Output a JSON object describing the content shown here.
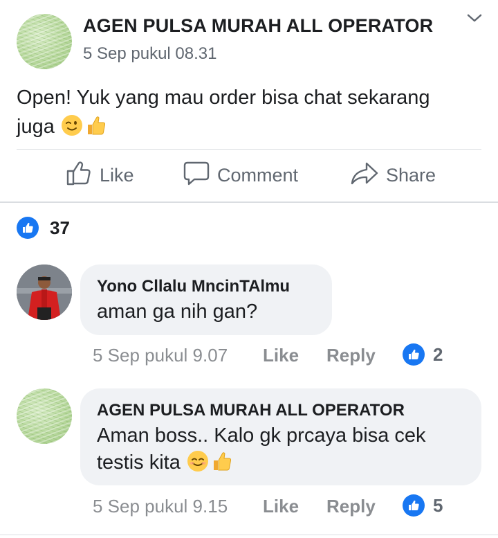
{
  "post": {
    "author": "AGEN PULSA MURAH ALL OPERATOR",
    "timestamp": "5 Sep pukul 08.31",
    "text_line1": "Open! Yuk yang mau order bisa chat sekarang",
    "text_line2": "juga",
    "emojis": [
      "winking-face-emoji",
      "thumbs-up-emoji"
    ]
  },
  "actions": {
    "like_label": "Like",
    "comment_label": "Comment",
    "share_label": "Share"
  },
  "reactions": {
    "count": "37",
    "icon": "like-reaction-icon"
  },
  "comments": [
    {
      "author": "Yono Cllalu MncinTAlmu",
      "text": "aman ga nih gan?",
      "timestamp": "5 Sep pukul 9.07",
      "like_label": "Like",
      "reply_label": "Reply",
      "like_count": "2"
    },
    {
      "author": "AGEN PULSA MURAH ALL OPERATOR",
      "text_line1": "Aman boss.. Kalo gk prcaya bisa cek",
      "text_line2": "testis kita",
      "emojis": [
        "smiling-face-emoji",
        "thumbs-up-emoji"
      ],
      "timestamp": "5 Sep pukul 9.15",
      "like_label": "Like",
      "reply_label": "Reply",
      "like_count": "5"
    }
  ],
  "colors": {
    "facebook_blue": "#1877f2",
    "bubble_gray": "#f0f2f5",
    "meta_gray": "#8a8d91",
    "divider": "#dadde1"
  }
}
